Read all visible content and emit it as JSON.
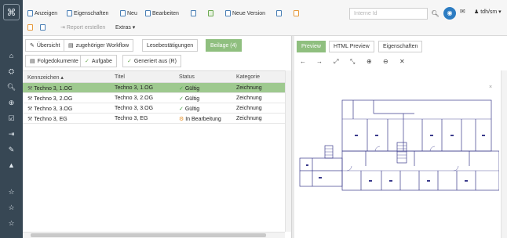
{
  "toolbar": {
    "anzeigen": "Anzeigen",
    "eigenschaften": "Eigenschaften",
    "neu": "Neu",
    "bearbeiten": "Bearbeiten",
    "neue_version": "Neue Version",
    "report": "Report erstellen",
    "extras": "Extras ▾",
    "search_placeholder": "Interne Id",
    "user": "tdh/sm ▾"
  },
  "tabs": [
    {
      "label": "Übersicht"
    },
    {
      "label": "zugehöriger Workflow"
    },
    {
      "label": "Lesebestätigungen"
    },
    {
      "label": "Beilage (4)"
    }
  ],
  "subtabs": [
    {
      "label": "Folgedokumente"
    },
    {
      "label": "Aufgabe"
    },
    {
      "label": "Generiert aus (R)"
    }
  ],
  "grid": {
    "headers": [
      "Kennzeichen ▴",
      "Titel",
      "Status",
      "Kategorie"
    ],
    "rows": [
      {
        "kennzeichen": "Techno 3, 1.OG",
        "titel": "Techno 3, 1.OG",
        "status": "Gültig",
        "kategorie": "Zeichnung",
        "selected": true,
        "status_type": "ok"
      },
      {
        "kennzeichen": "Techno 3, 2.OG",
        "titel": "Techno 3, 2.OG",
        "status": "Gültig",
        "kategorie": "Zeichnung",
        "selected": false,
        "status_type": "ok"
      },
      {
        "kennzeichen": "Techno 3, 3.OG",
        "titel": "Techno 3, 3.OG",
        "status": "Gültig",
        "kategorie": "Zeichnung",
        "selected": false,
        "status_type": "ok"
      },
      {
        "kennzeichen": "Techno 3, EG",
        "titel": "Techno 3, EG",
        "status": "In Bearbeitung",
        "kategorie": "Zeichnung",
        "selected": false,
        "status_type": "wip"
      }
    ]
  },
  "preview_tabs": [
    {
      "label": "Preview"
    },
    {
      "label": "HTML Preview"
    },
    {
      "label": "Eigenschaften"
    }
  ],
  "viewer_tools": [
    "←",
    "→",
    "⤢",
    "⤡",
    "⊕",
    "⊖",
    "✕"
  ],
  "icons": {
    "rail": [
      "home-icon",
      "sitemap-icon",
      "search-icon",
      "search-plus-icon",
      "check-square-icon",
      "sign-in-icon",
      "pencil-icon",
      "graduation-cap-icon",
      "star-icon",
      "star-icon",
      "star-icon"
    ]
  },
  "colors": {
    "rail_bg": "#374754",
    "accent_blue": "#2c7cc2",
    "selected_row": "#9ec98f",
    "active_tab": "#8fbf7f"
  }
}
